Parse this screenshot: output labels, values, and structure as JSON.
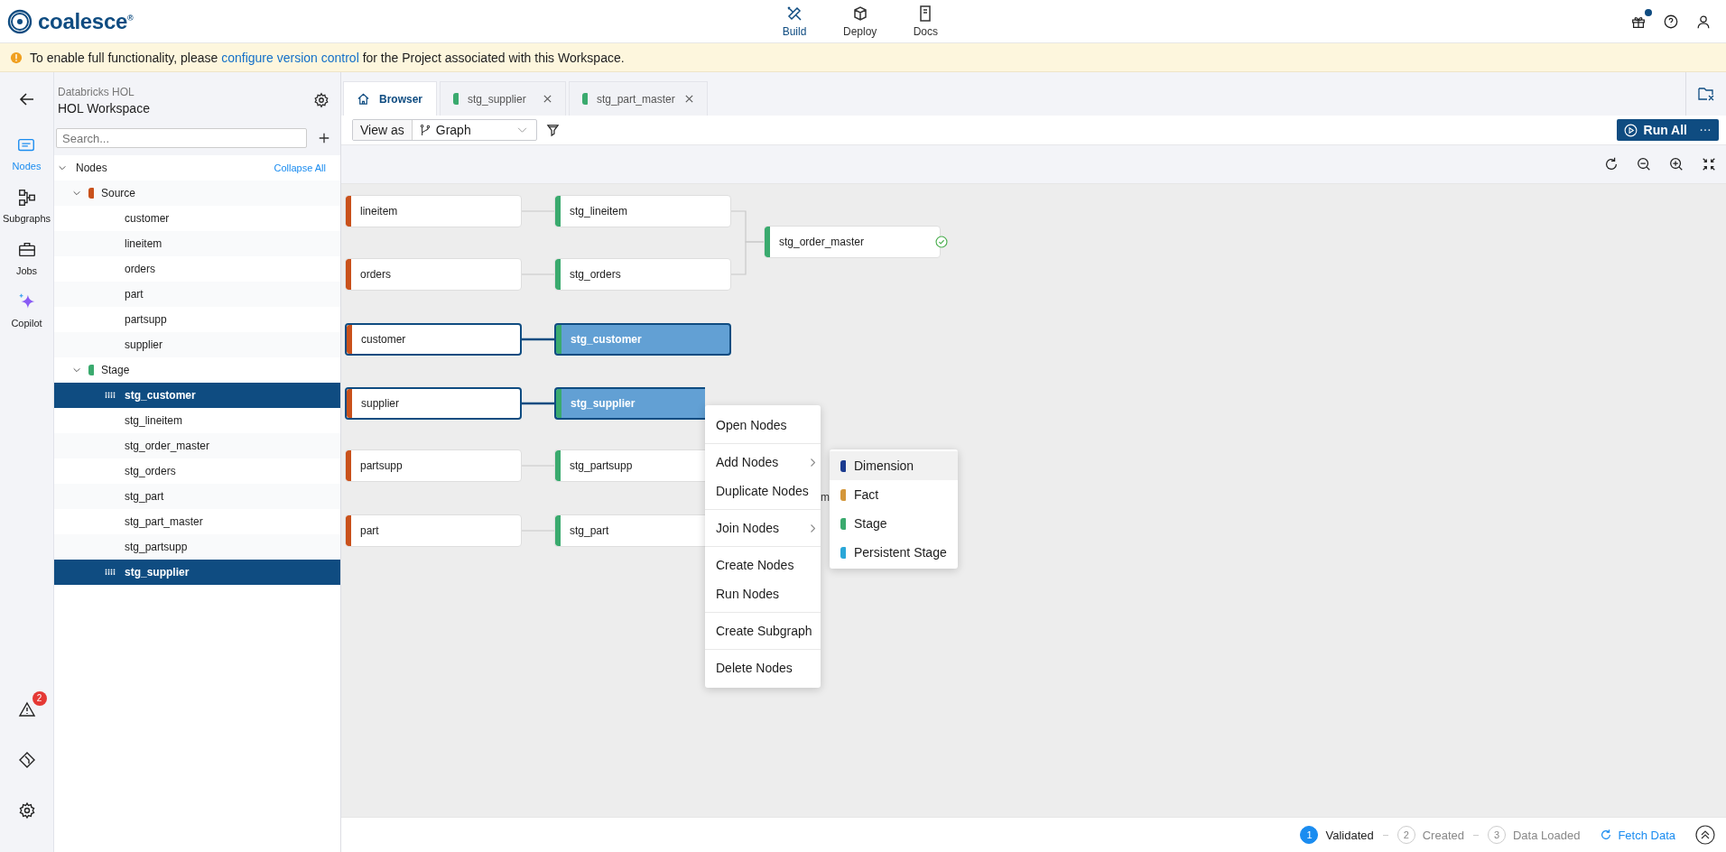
{
  "app": {
    "logo_text": "coalesce",
    "trademark": "®"
  },
  "top_nav": [
    {
      "label": "Build",
      "selected": true
    },
    {
      "label": "Deploy",
      "selected": false
    },
    {
      "label": "Docs",
      "selected": false
    }
  ],
  "header_actions": {
    "gift_notification": true
  },
  "banner": {
    "before": "To enable full functionality, please ",
    "link": "configure version control",
    "after": " for the Project associated with this Workspace."
  },
  "rail": [
    {
      "label": "Nodes",
      "selected": true
    },
    {
      "label": "Subgraphs",
      "selected": false
    },
    {
      "label": "Jobs",
      "selected": false
    },
    {
      "label": "Copilot",
      "selected": false
    }
  ],
  "rail_bottom": {
    "warning_count": "2"
  },
  "workspace": {
    "project": "Databricks HOL",
    "name": "HOL Workspace"
  },
  "search": {
    "placeholder": "Search..."
  },
  "tree": {
    "label": "Nodes",
    "expanded": true,
    "collapse_all": "Collapse All",
    "children": [
      {
        "label": "Source",
        "color": "#c9511b",
        "expanded": true,
        "children": [
          {
            "label": "customer",
            "selected": false
          },
          {
            "label": "lineitem",
            "selected": false
          },
          {
            "label": "orders",
            "selected": false
          },
          {
            "label": "part",
            "selected": false
          },
          {
            "label": "partsupp",
            "selected": false
          },
          {
            "label": "supplier",
            "selected": false
          }
        ]
      },
      {
        "label": "Stage",
        "color": "#3aaa6e",
        "expanded": true,
        "children": [
          {
            "label": "stg_customer",
            "selected": true
          },
          {
            "label": "stg_lineitem",
            "selected": false
          },
          {
            "label": "stg_order_master",
            "selected": false
          },
          {
            "label": "stg_orders",
            "selected": false
          },
          {
            "label": "stg_part",
            "selected": false
          },
          {
            "label": "stg_part_master",
            "selected": false
          },
          {
            "label": "stg_partsupp",
            "selected": false
          },
          {
            "label": "stg_supplier",
            "selected": true
          }
        ]
      }
    ]
  },
  "tabs": [
    {
      "kind": "home",
      "label": "Browser",
      "selected": true
    },
    {
      "kind": "node",
      "label": "stg_supplier",
      "color": "#3aaa6e",
      "selected": false
    },
    {
      "kind": "node",
      "label": "stg_part_master",
      "color": "#3aaa6e",
      "selected": false
    }
  ],
  "toolbar": {
    "view_as": "View as",
    "view": "Graph",
    "run_all": "Run All"
  },
  "graph": {
    "columns": [
      [
        {
          "label": "lineitem",
          "color": "#c9511b",
          "selected": false
        },
        {
          "label": "orders",
          "color": "#c9511b",
          "selected": false
        },
        {
          "label": "customer",
          "color": "#c9511b",
          "selected": true
        },
        {
          "label": "supplier",
          "color": "#c9511b",
          "selected": true
        },
        {
          "label": "partsupp",
          "color": "#c9511b",
          "selected": false
        },
        {
          "label": "part",
          "color": "#c9511b",
          "selected": false
        }
      ],
      [
        {
          "label": "stg_lineitem",
          "color": "#3aaa6e",
          "selected": false
        },
        {
          "label": "stg_orders",
          "color": "#3aaa6e",
          "selected": false
        },
        {
          "label": "stg_customer",
          "color": "#3aaa6e",
          "selected": true
        },
        {
          "label": "stg_supplier",
          "color": "#3aaa6e",
          "selected": true
        },
        {
          "label": "stg_partsupp",
          "color": "#3aaa6e",
          "selected": false
        },
        {
          "label": "stg_part",
          "color": "#3aaa6e",
          "selected": false
        }
      ],
      [
        {
          "label": "stg_order_master",
          "color": "#3aaa6e",
          "selected": false,
          "validated": true
        }
      ]
    ],
    "hidden_label_fragment": "m"
  },
  "context_menu": [
    [
      {
        "label": "Open Nodes",
        "submenu": false
      }
    ],
    [
      {
        "label": "Add Nodes",
        "submenu": true
      },
      {
        "label": "Duplicate Nodes",
        "submenu": false
      }
    ],
    [
      {
        "label": "Join Nodes",
        "submenu": true
      }
    ],
    [
      {
        "label": "Create Nodes",
        "submenu": false
      },
      {
        "label": "Run Nodes",
        "submenu": false
      }
    ],
    [
      {
        "label": "Create Subgraph",
        "submenu": false
      }
    ],
    [
      {
        "label": "Delete Nodes",
        "submenu": false
      }
    ]
  ],
  "submenu": [
    {
      "label": "Dimension",
      "color": "#1a3a8f",
      "selected": true
    },
    {
      "label": "Fact",
      "color": "#d4973b",
      "selected": false
    },
    {
      "label": "Stage",
      "color": "#3aaa6e",
      "selected": false
    },
    {
      "label": "Persistent Stage",
      "color": "#2aa7d8",
      "selected": false
    }
  ],
  "status_bar": {
    "steps": [
      {
        "number": "1",
        "label": "Validated",
        "selected": true
      },
      {
        "number": "2",
        "label": "Created",
        "selected": false
      },
      {
        "number": "3",
        "label": "Data Loaded",
        "selected": false
      }
    ],
    "fetch": "Fetch Data"
  }
}
